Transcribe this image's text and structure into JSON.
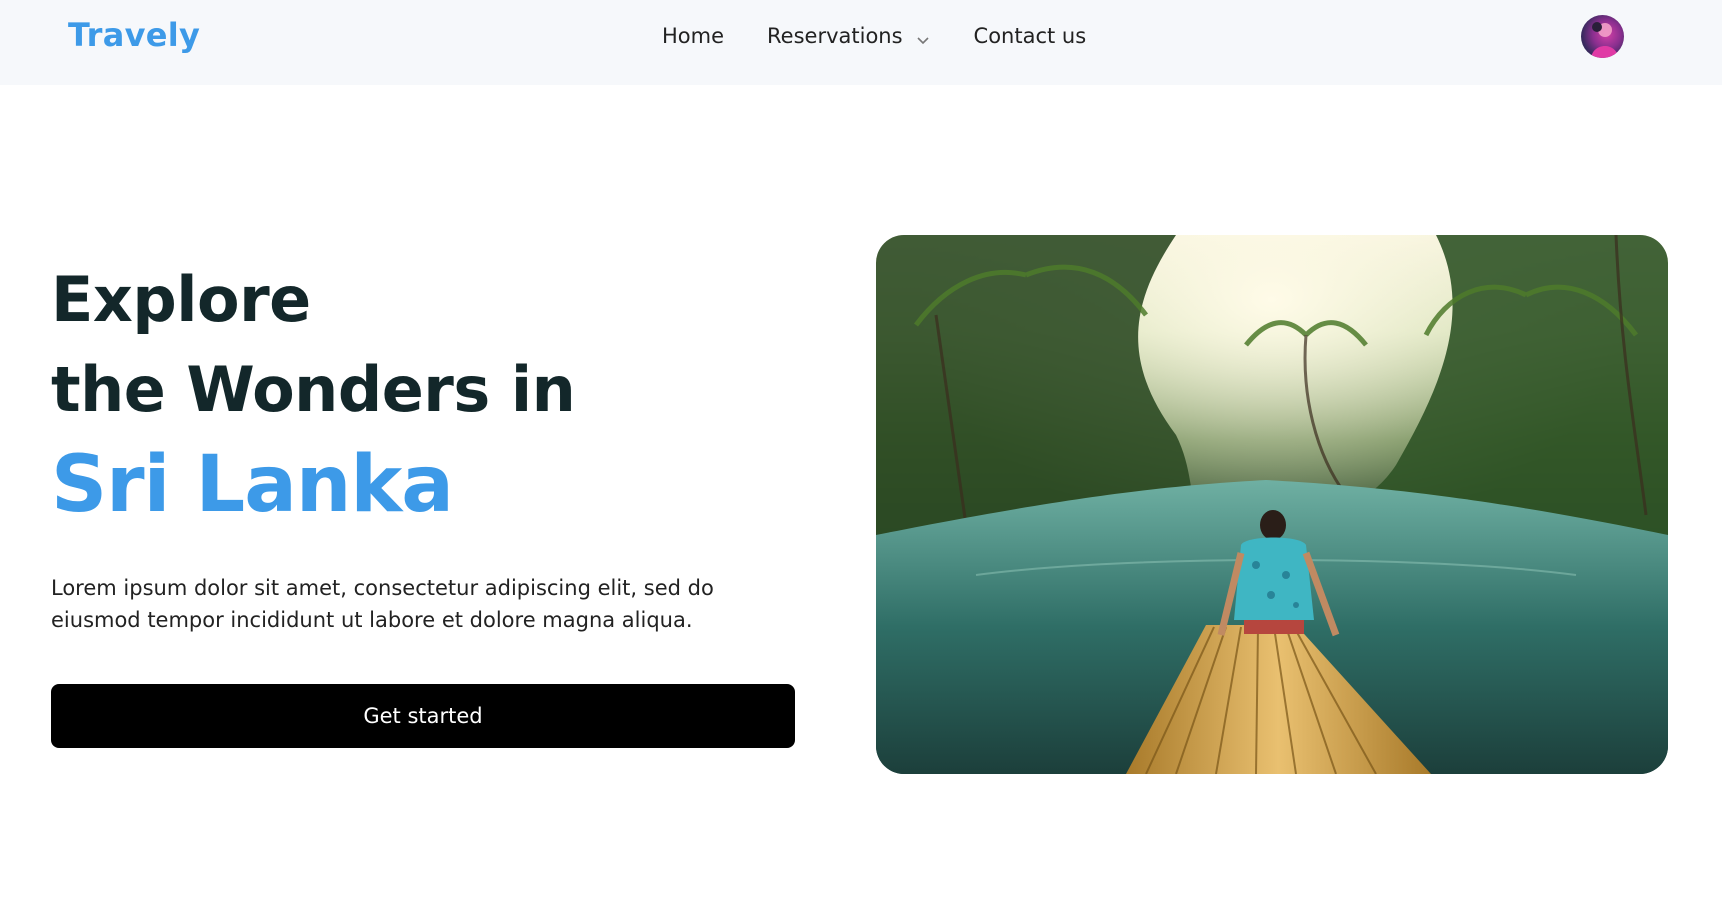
{
  "brand": {
    "name": "Travely",
    "color": "#3d9ae8"
  },
  "nav": {
    "items": [
      {
        "label": "Home"
      },
      {
        "label": "Reservations",
        "icon": "chevron-down-icon"
      },
      {
        "label": "Contact us"
      }
    ],
    "avatar_icon": "user-avatar"
  },
  "hero": {
    "line1": "Explore",
    "line2": "the Wonders in",
    "accent": "Sri Lanka",
    "description": "Lorem ipsum dolor sit amet, consectetur adipiscing elit, sed do eiusmod tempor incididunt ut labore et dolore magna aliqua.",
    "cta_label": "Get started",
    "image_subject": "man-on-bamboo-raft-tropical-river-image"
  },
  "colors": {
    "accent": "#3d9ae8",
    "heading": "#13272a",
    "button_bg": "#000000"
  }
}
